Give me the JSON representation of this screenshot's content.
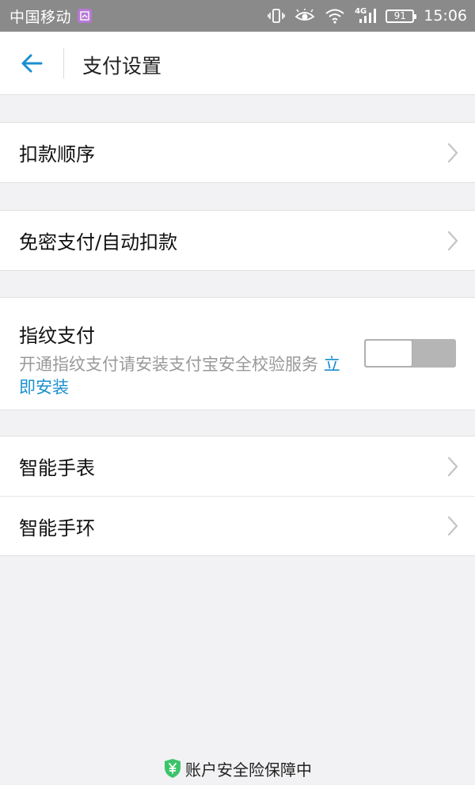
{
  "status_bar": {
    "carrier": "中国移动",
    "network": "4G",
    "battery": "91",
    "time": "15:06"
  },
  "header": {
    "title": "支付设置"
  },
  "settings": {
    "deduction_order": "扣款顺序",
    "password_free": "免密支付/自动扣款",
    "fingerprint": {
      "title": "指纹支付",
      "description": "开通指纹支付请安装支付宝安全校验服务",
      "link": "立即安装",
      "toggle_on": false
    },
    "smart_watch": "智能手表",
    "smart_band": "智能手环"
  },
  "footer": {
    "text": "账户安全险保障中"
  },
  "colors": {
    "accent": "#1a8fd0",
    "shield": "#3cc46a",
    "status_bar": "#8a8a8a"
  },
  "icons": [
    "back-arrow-icon",
    "chevron-right-icon",
    "shield-icon",
    "vibrate-icon",
    "eye-icon",
    "wifi-icon",
    "signal-icon",
    "battery-icon"
  ]
}
